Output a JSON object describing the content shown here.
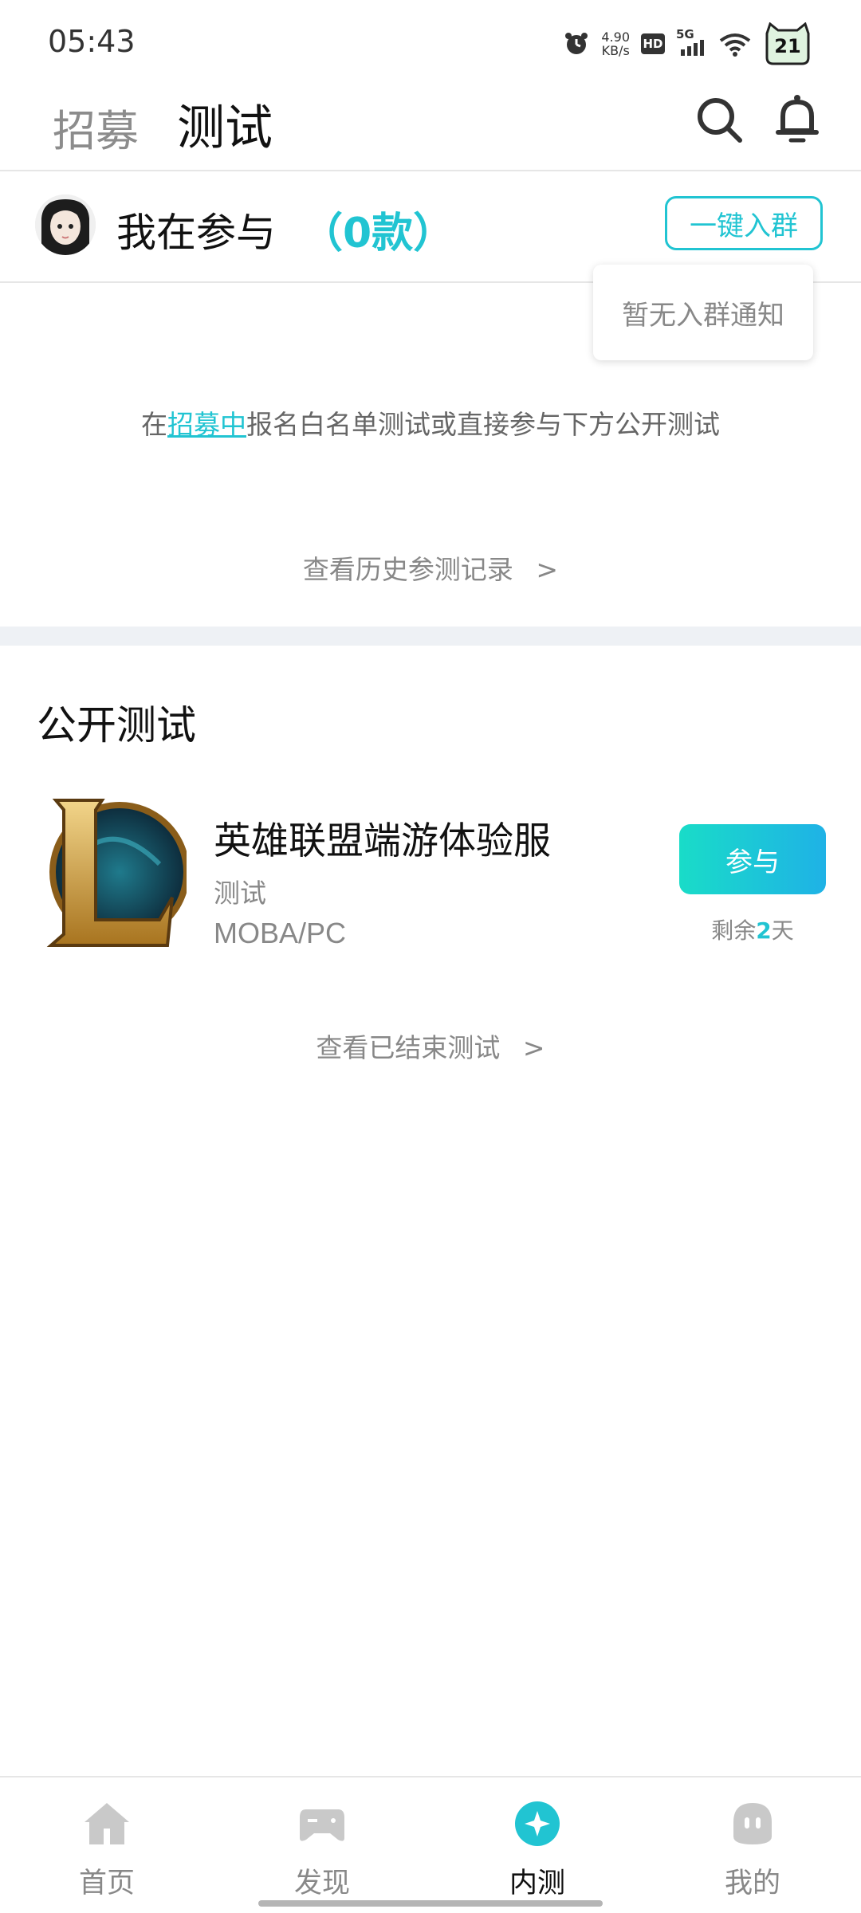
{
  "status_bar": {
    "time": "05:43",
    "speed_value": "4.90",
    "speed_unit": "KB/s",
    "hd_label": "HD",
    "network": "5G",
    "battery_level": "21"
  },
  "header": {
    "tabs": [
      {
        "label": "招募",
        "active": false
      },
      {
        "label": "测试",
        "active": true
      }
    ],
    "icons": [
      "search-icon",
      "bell-icon"
    ]
  },
  "participating": {
    "label": "我在参与",
    "count_text": "（0款）",
    "join_group_button": "一键入群",
    "popup_text": "暂无入群通知"
  },
  "hint": {
    "prefix": "在",
    "link": "招募中",
    "suffix": "报名白名单测试或直接参与下方公开测试"
  },
  "history_link": "查看历史参测记录",
  "public_tests": {
    "title": "公开测试",
    "items": [
      {
        "name": "英雄联盟端游体验服",
        "tag": "测试",
        "category": "MOBA/PC",
        "button": "参与",
        "remaining_prefix": "剩余",
        "remaining_days": "2",
        "remaining_suffix": "天"
      }
    ]
  },
  "ended_link": "查看已结束测试",
  "bottom_nav": [
    {
      "label": "首页",
      "icon": "home-icon",
      "active": false
    },
    {
      "label": "发现",
      "icon": "gamepad-icon",
      "active": false
    },
    {
      "label": "内测",
      "icon": "beta-test-icon",
      "active": true
    },
    {
      "label": "我的",
      "icon": "profile-icon",
      "active": false
    }
  ],
  "colors": {
    "accent": "#21c4d2",
    "button_gradient_start": "#19dcc8",
    "button_gradient_end": "#1fb2e6",
    "muted_text": "#888888",
    "section_gap": "#eef1f5"
  }
}
